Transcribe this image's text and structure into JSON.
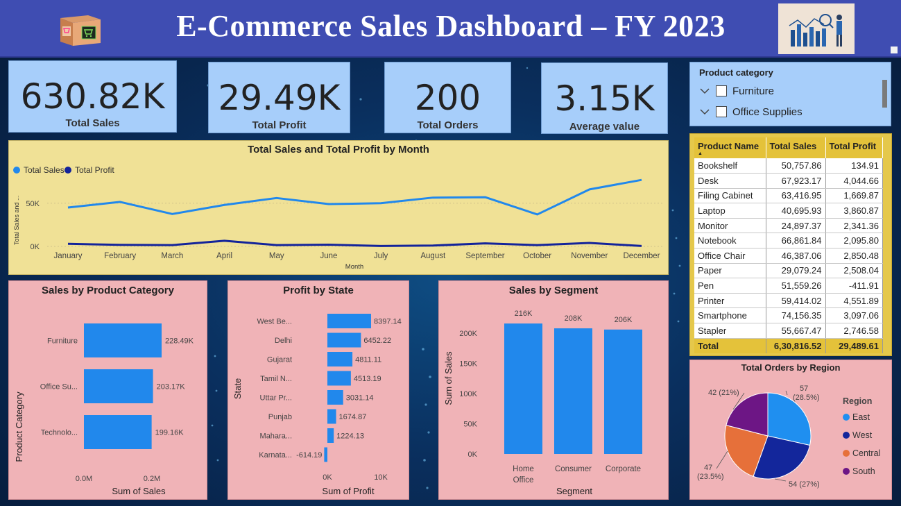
{
  "header": {
    "title": "E-Commerce Sales Dashboard – FY 2023",
    "logo_left": "shopping-cart-box-icon",
    "logo_right": "analytics-chart-person-icon"
  },
  "kpis": [
    {
      "value": "630.82K",
      "label": "Total Sales"
    },
    {
      "value": "29.49K",
      "label": "Total Profit"
    },
    {
      "value": "200",
      "label": "Total Orders"
    },
    {
      "value": "3.15K",
      "label": "Average value"
    }
  ],
  "slicer": {
    "title": "Product category",
    "options": [
      "Furniture",
      "Office Supplies"
    ]
  },
  "product_table": {
    "headers": [
      "Product Name",
      "Total Sales",
      "Total Profit"
    ],
    "rows": [
      [
        "Bookshelf",
        "50,757.86",
        "134.91"
      ],
      [
        "Desk",
        "67,923.17",
        "4,044.66"
      ],
      [
        "Filing Cabinet",
        "63,416.95",
        "1,669.87"
      ],
      [
        "Laptop",
        "40,695.93",
        "3,860.87"
      ],
      [
        "Monitor",
        "24,897.37",
        "2,341.36"
      ],
      [
        "Notebook",
        "66,861.84",
        "2,095.80"
      ],
      [
        "Office Chair",
        "46,387.06",
        "2,850.48"
      ],
      [
        "Paper",
        "29,079.24",
        "2,508.04"
      ],
      [
        "Pen",
        "51,559.26",
        "-411.91"
      ],
      [
        "Printer",
        "59,414.02",
        "4,551.89"
      ],
      [
        "Smartphone",
        "74,156.35",
        "3,097.06"
      ],
      [
        "Stapler",
        "55,667.47",
        "2,746.58"
      ]
    ],
    "total": [
      "Total",
      "6,30,816.52",
      "29,489.61"
    ]
  },
  "colors": {
    "sales": "#2188ec",
    "profit": "#13239a",
    "east": "#1f8ff0",
    "west": "#13269b",
    "central": "#e6703a",
    "south": "#6d1685"
  },
  "chart_data": [
    {
      "type": "line",
      "title": "Total Sales and Total Profit by Month",
      "xlabel": "Month",
      "ylabel": "Total Sales and ...",
      "categories": [
        "January",
        "February",
        "March",
        "April",
        "May",
        "June",
        "July",
        "August",
        "September",
        "October",
        "November",
        "December"
      ],
      "series": [
        {
          "name": "Total Sales",
          "values": [
            45000,
            51500,
            37500,
            48000,
            56000,
            49000,
            50000,
            56500,
            57000,
            37000,
            66000,
            77000
          ]
        },
        {
          "name": "Total Profit",
          "values": [
            3000,
            1800,
            1500,
            6500,
            1500,
            2000,
            500,
            1000,
            3500,
            1500,
            4000,
            500
          ]
        }
      ],
      "yticks": [
        "0K",
        "50K"
      ],
      "ylim": [
        0,
        90000
      ],
      "legend": "top-left"
    },
    {
      "type": "bar",
      "orientation": "horizontal",
      "title": "Sales by Product Category",
      "xlabel": "Sum of Sales",
      "ylabel": "Product Category",
      "categories": [
        "Furniture",
        "Office Su...",
        "Technolo..."
      ],
      "values": [
        228490,
        203170,
        199160
      ],
      "data_labels": [
        "228.49K",
        "203.17K",
        "199.16K"
      ],
      "xticks": [
        "0.0M",
        "0.2M"
      ],
      "xlim": [
        0,
        250000
      ]
    },
    {
      "type": "bar",
      "orientation": "horizontal",
      "title": "Profit by State",
      "xlabel": "Sum of Profit",
      "ylabel": "State",
      "categories": [
        "West Be...",
        "Delhi",
        "Gujarat",
        "Tamil N...",
        "Uttar Pr...",
        "Punjab",
        "Mahara...",
        "Karnata..."
      ],
      "values": [
        8397.14,
        6452.22,
        4811.11,
        4513.19,
        3031.14,
        1674.87,
        1224.13,
        -614.19
      ],
      "data_labels": [
        "8397.14",
        "6452.22",
        "4811.11",
        "4513.19",
        "3031.14",
        "1674.87",
        "1224.13",
        "-614.19"
      ],
      "xticks": [
        "0K",
        "10K"
      ],
      "xlim": [
        -1000,
        10000
      ]
    },
    {
      "type": "bar",
      "title": "Sales by Segment",
      "xlabel": "Segment",
      "ylabel": "Sum of Sales",
      "categories": [
        [
          "Home",
          "Office"
        ],
        [
          "Consumer"
        ],
        [
          "Corporate"
        ]
      ],
      "values": [
        216000,
        208000,
        206000
      ],
      "data_labels": [
        "216K",
        "208K",
        "206K"
      ],
      "yticks": [
        "0K",
        "50K",
        "100K",
        "150K",
        "200K"
      ],
      "ylim": [
        0,
        240000
      ]
    },
    {
      "type": "pie",
      "title": "Total Orders by Region",
      "legend_title": "Region",
      "categories": [
        "East",
        "West",
        "Central",
        "South"
      ],
      "values": [
        57,
        54,
        47,
        42
      ],
      "data_labels": [
        [
          "57",
          "(28.5%)"
        ],
        [
          "54 (27%)"
        ],
        [
          "47",
          "(23.5%)"
        ],
        [
          "42 (21%)"
        ]
      ],
      "legend": "right"
    }
  ]
}
